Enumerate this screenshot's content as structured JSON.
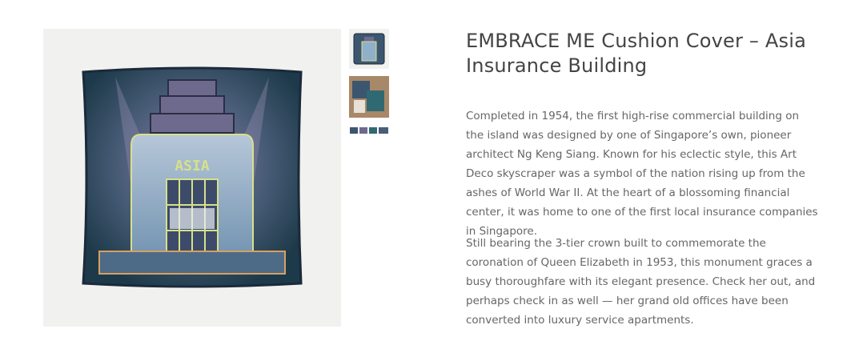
{
  "product": {
    "title": "EMBRACE ME Cushion Cover – Asia Insurance Building",
    "main_image_sign": "ASIA",
    "description": [
      "Completed in 1954, the first high-rise commercial building on the island was designed by one of Singapore’s own, pioneer architect Ng Keng Siang. Known for his eclectic style, this Art Deco skyscraper was a symbol of the nation rising up from the ashes of World War II. At the heart of a blossoming financial center, it was home to one of the first local insurance companies in Singapore.",
      "Still bearing the 3-tier crown built to commemorate the coronation of Queen Elizabeth in 1953, this monument graces a busy thoroughfare with its elegant presence. Check her out, and perhaps check in as well — her grand old offices have been converted into luxury service apartments."
    ]
  },
  "colors": {
    "cushion_dark": "#1d3a4a",
    "cushion_purple": "#6e6a8e",
    "building_blue": "#8fb0c8",
    "sign_yellow": "#d8e08a",
    "title_text": "#444444",
    "body_text": "#666666"
  },
  "thumbnails": [
    {
      "name": "cushion-front"
    },
    {
      "name": "lifestyle-shot"
    },
    {
      "name": "range-strip"
    }
  ]
}
